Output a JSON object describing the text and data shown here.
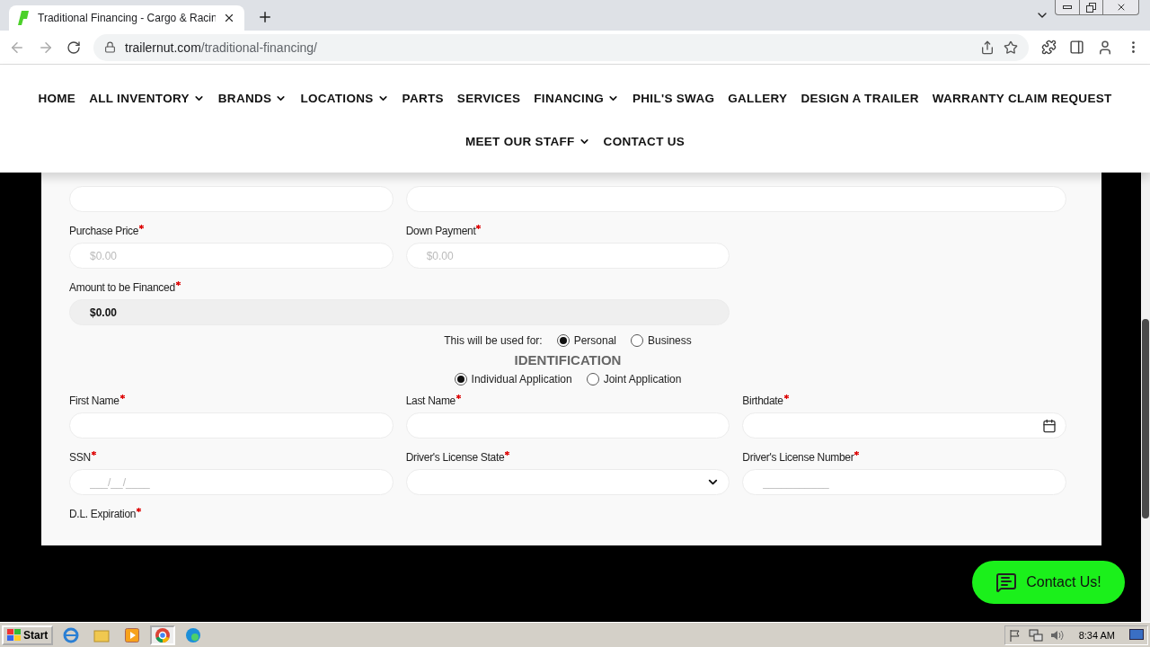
{
  "browser": {
    "tab_title": "Traditional Financing - Cargo & Racin",
    "url_domain": "trailernut.com",
    "url_path": "/traditional-financing/"
  },
  "nav": {
    "items": [
      {
        "label": "HOME",
        "dropdown": false
      },
      {
        "label": "ALL INVENTORY",
        "dropdown": true
      },
      {
        "label": "BRANDS",
        "dropdown": true
      },
      {
        "label": "LOCATIONS",
        "dropdown": true
      },
      {
        "label": "PARTS",
        "dropdown": false
      },
      {
        "label": "SERVICES",
        "dropdown": false
      },
      {
        "label": "FINANCING",
        "dropdown": true
      },
      {
        "label": "PHIL'S SWAG",
        "dropdown": false
      },
      {
        "label": "GALLERY",
        "dropdown": false
      },
      {
        "label": "DESIGN A TRAILER",
        "dropdown": false
      },
      {
        "label": "WARRANTY CLAIM REQUEST",
        "dropdown": false
      },
      {
        "label": "MEET OUR STAFF",
        "dropdown": true
      },
      {
        "label": "CONTACT US",
        "dropdown": false
      }
    ]
  },
  "form": {
    "sections": [
      {
        "kind": "fields",
        "fields": [
          {
            "kind": "text"
          },
          {
            "kind": "text"
          }
        ]
      },
      {
        "kind": "fields",
        "fields": [
          {
            "kind": "text",
            "label": "Purchase Price",
            "required": true,
            "placeholder": "$0.00"
          },
          {
            "kind": "text",
            "label": "Down Payment",
            "required": true,
            "placeholder": "$0.00"
          }
        ]
      },
      {
        "kind": "fields",
        "fields": [
          {
            "kind": "readonly",
            "label": "Amount to be Financed",
            "required": true,
            "value": "$0.00"
          }
        ]
      },
      {
        "kind": "radios",
        "label": "This will be used for:",
        "options": [
          {
            "label": "Personal",
            "selected": true
          },
          {
            "label": "Business",
            "selected": false
          }
        ]
      },
      {
        "kind": "heading",
        "text": "IDENTIFICATION"
      },
      {
        "kind": "radios",
        "options": [
          {
            "label": "Individual Application",
            "selected": true
          },
          {
            "label": "Joint Application",
            "selected": false
          }
        ]
      },
      {
        "kind": "fields",
        "fields": [
          {
            "kind": "text",
            "label": "First Name",
            "required": true
          },
          {
            "kind": "text",
            "label": "Last Name",
            "required": true
          },
          {
            "kind": "date",
            "label": "Birthdate",
            "required": true
          }
        ]
      },
      {
        "kind": "fields",
        "fields": [
          {
            "kind": "text",
            "label": "SSN",
            "required": true,
            "placeholder": "___/__/____"
          },
          {
            "kind": "select",
            "label": "Driver's License State",
            "required": true
          },
          {
            "kind": "text",
            "label": "Driver's License Number",
            "required": true,
            "placeholder": "___________"
          }
        ]
      },
      {
        "kind": "fields",
        "fields": [
          {
            "kind": "label",
            "label": "D.L. Expiration",
            "required": true
          }
        ]
      }
    ]
  },
  "contact_button": {
    "label": "Contact Us!"
  },
  "taskbar": {
    "start": "Start",
    "clock": "8:34 AM"
  }
}
